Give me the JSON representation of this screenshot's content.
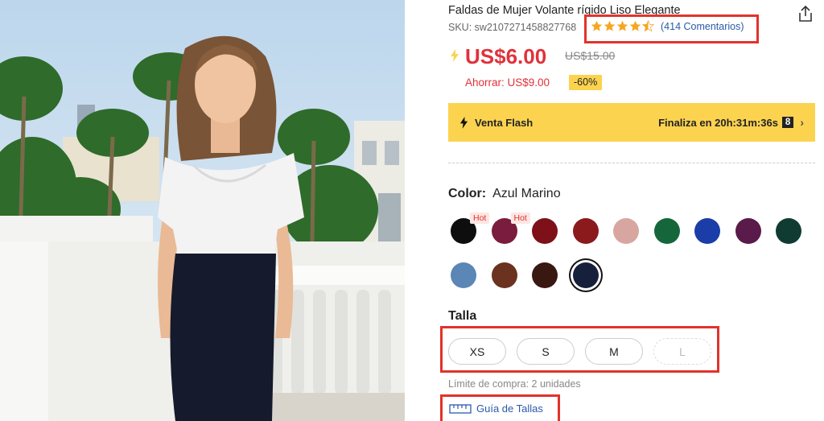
{
  "product": {
    "title": "Faldas de Mujer Volante rígido Liso Elegante",
    "sku": "SKU: sw2107271458827768",
    "rating_value": 4.5,
    "reviews_label": "(414 Comentarios)",
    "price": "US$6.00",
    "old_price": "US$15.00",
    "savings": "Ahorrar: US$9.00",
    "discount": "-60%"
  },
  "flash_sale": {
    "label": "Venta Flash",
    "countdown": "Finaliza en 20h:31m:36s",
    "badge": "8"
  },
  "color": {
    "label": "Color:",
    "selected": "Azul Marino",
    "swatches": [
      {
        "hex": "#0e0e0e",
        "badge": "Hot"
      },
      {
        "hex": "#7a1c3d",
        "badge": "Hot"
      },
      {
        "hex": "#7e1019"
      },
      {
        "hex": "#8a1a1c"
      },
      {
        "hex": "#d8a6a0"
      },
      {
        "hex": "#15673b"
      },
      {
        "hex": "#1a3da8"
      },
      {
        "hex": "#5a1a4a"
      },
      {
        "hex": "#0f3b33"
      },
      {
        "hex": "#5b86b5"
      },
      {
        "hex": "#6a321f"
      },
      {
        "hex": "#3a1812"
      },
      {
        "hex": "#17203b",
        "selected": true
      }
    ]
  },
  "size": {
    "label": "Talla",
    "options": [
      {
        "label": "XS",
        "available": true
      },
      {
        "label": "S",
        "available": true
      },
      {
        "label": "M",
        "available": true
      },
      {
        "label": "L",
        "available": false
      }
    ],
    "limit_text": "Límite de compra: 2 unidades",
    "guide_label": "Guía de Tallas"
  },
  "colors": {
    "accent_red": "#e0323a",
    "flash_yellow": "#fcd34f",
    "link_blue": "#2b5aa9",
    "annotation_red": "#e2332a",
    "star_orange": "#f5a623"
  },
  "icons": {
    "share": "share-icon",
    "flash": "lightning-bolt-icon",
    "ruler": "ruler-icon",
    "star": "star-icon"
  }
}
